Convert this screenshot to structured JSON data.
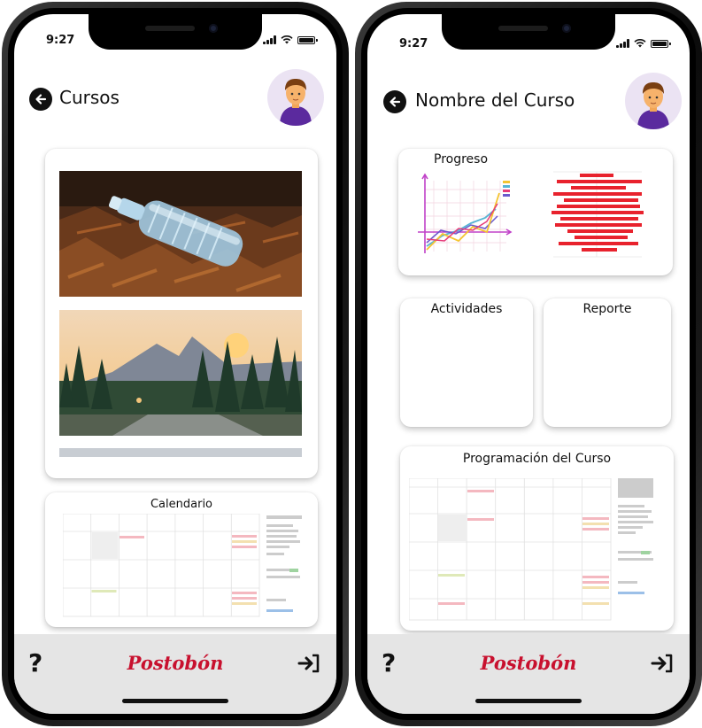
{
  "status_bar": {
    "time": "9:27"
  },
  "screen_courses": {
    "title": "Cursos",
    "calendar_title": "Calendario"
  },
  "screen_course": {
    "title": "Nombre del Curso",
    "progress_title": "Progreso",
    "activities_title": "Actividades",
    "report_title": "Reporte",
    "schedule_title": "Programación del Curso"
  },
  "footer": {
    "help_label": "?",
    "brand": "Postobón"
  },
  "icons": {
    "back": "arrow-left-icon",
    "avatar": "user-avatar-icon",
    "help": "question-mark-icon",
    "login": "login-arrow-icon",
    "signal": "cell-signal-icon",
    "wifi": "wifi-icon",
    "battery": "battery-icon"
  },
  "colors": {
    "brand_red": "#c8102e",
    "footer_bg": "#e5e5e5",
    "avatar_bg": "#ebe3f3",
    "shirt": "#5b2a9e"
  }
}
